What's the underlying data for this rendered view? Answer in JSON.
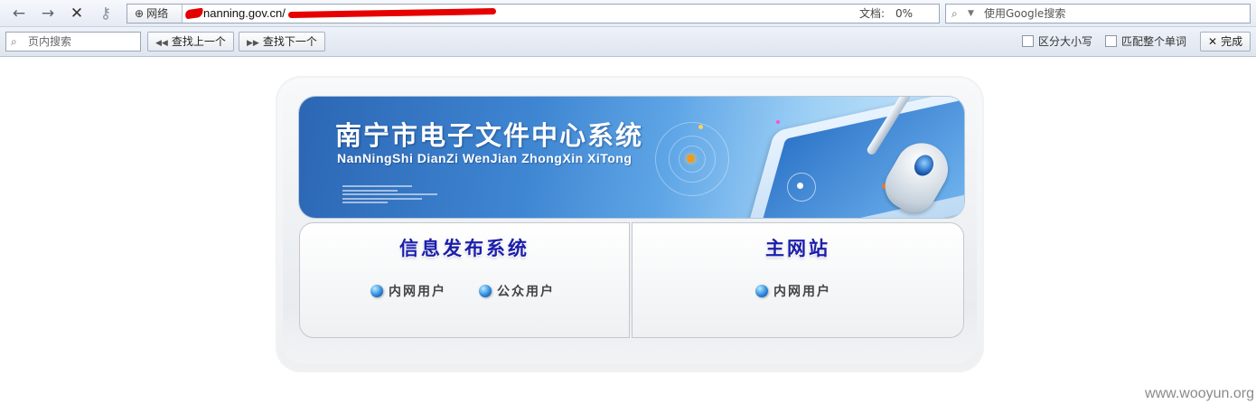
{
  "browser": {
    "nav": {
      "back": "←",
      "forward": "→",
      "stop": "✕",
      "key": "⚷"
    },
    "address": {
      "net_chip": "网络",
      "url_visible": "nanning.gov.cn/",
      "doc_label": "文档:",
      "doc_progress": "0%"
    },
    "search": {
      "placeholder": "使用Google搜索"
    }
  },
  "find_bar": {
    "placeholder": "页内搜索",
    "prev_label": "查找上一个",
    "next_label": "查找下一个",
    "match_case": "区分大小写",
    "whole_word": "匹配整个单词",
    "done_label": "完成"
  },
  "page": {
    "banner": {
      "title": "南宁市电子文件中心系统",
      "subtitle": "NanNingShi DianZi WenJian ZhongXin XiTong"
    },
    "panels": [
      {
        "title": "信息发布系统",
        "links": [
          "内网用户",
          "公众用户"
        ]
      },
      {
        "title": "主网站",
        "links": [
          "内网用户"
        ]
      }
    ]
  },
  "watermark": "www.wooyun.org",
  "colors": {
    "panel_title": "#1b1eaa",
    "banner_blue": "#3f86d2",
    "redaction": "#e30000"
  }
}
